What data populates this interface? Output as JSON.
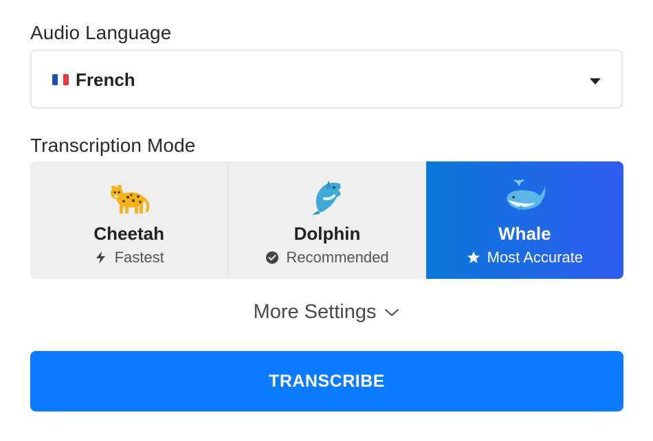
{
  "audio_language": {
    "label": "Audio Language",
    "selected": "French",
    "flag_icon": "france-flag-icon",
    "flag_colors": [
      "#1f4fb4",
      "#ffffff",
      "#e53945"
    ]
  },
  "transcription_mode": {
    "label": "Transcription Mode",
    "options": [
      {
        "name": "Cheetah",
        "subtitle": "Fastest",
        "emoji_icon": "leopard-icon",
        "subtitle_icon": "lightning-bolt-icon",
        "selected": false
      },
      {
        "name": "Dolphin",
        "subtitle": "Recommended",
        "emoji_icon": "dolphin-icon",
        "subtitle_icon": "check-circle-icon",
        "selected": false
      },
      {
        "name": "Whale",
        "subtitle": "Most Accurate",
        "emoji_icon": "whale-icon",
        "subtitle_icon": "star-icon",
        "selected": true
      }
    ]
  },
  "more_settings": {
    "label": "More Settings",
    "icon": "chevron-down-icon"
  },
  "transcribe_button": {
    "label": "TRANSCRIBE"
  },
  "colors": {
    "accent": "#0b7cff",
    "selected_gradient_start": "#0a78d8",
    "selected_gradient_end": "#2f5cf0",
    "option_background": "#efefef"
  }
}
